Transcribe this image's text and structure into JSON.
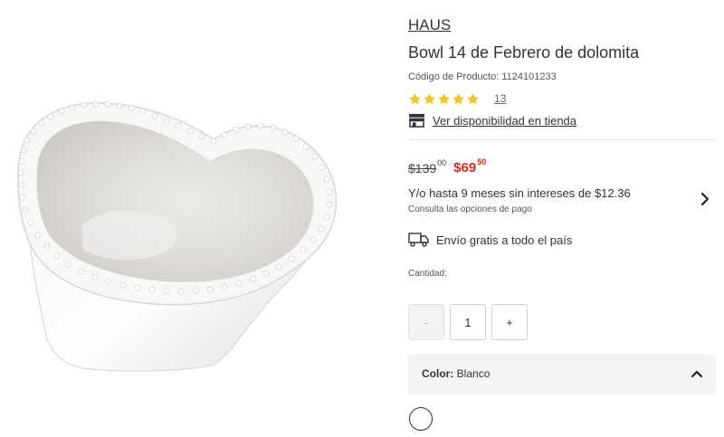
{
  "product": {
    "brand": "HAUS",
    "title": "Bowl 14 de Febrero de dolomita",
    "code_text": "Código de Producto: 1124101233",
    "image_icon": "heart-shaped-bowl-image"
  },
  "rating": {
    "stars": 5,
    "count": "13",
    "star_color": "#f5c518"
  },
  "store": {
    "link_text": "Ver disponibilidad en tienda",
    "icon": "store-icon"
  },
  "price": {
    "old_whole": "$139",
    "old_cents": "00",
    "new_whole": "$69",
    "new_cents": "50",
    "sale_color": "#e1251b"
  },
  "installments": {
    "text": "Y/o hasta 9 meses sin intereses de $12.36",
    "subtext": "Consulta las opciones de pago",
    "icon": "chevron-right-icon"
  },
  "shipping": {
    "text": "Envío gratis a todo el país",
    "icon": "truck-icon"
  },
  "quantity": {
    "label": "Cantidad:",
    "decrement_label": "-",
    "value": "1",
    "increment_label": "+"
  },
  "color": {
    "label": "Color:",
    "value": "Blanco",
    "icon": "chevron-up-icon",
    "swatch_color": "#ffffff"
  }
}
